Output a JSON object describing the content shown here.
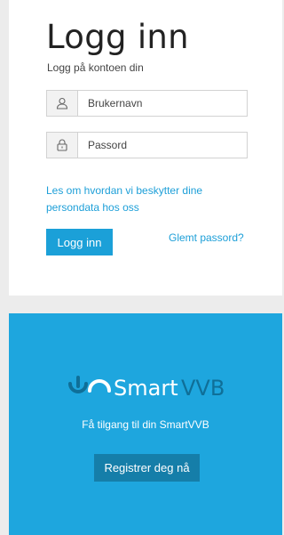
{
  "login": {
    "title": "Logg inn",
    "subtitle": "Logg på kontoen din",
    "username_placeholder": "Brukernavn",
    "password_placeholder": "Passord",
    "privacy_link": "Les om hvordan vi beskytter dine persondata hos oss",
    "login_button": "Logg inn",
    "forgot_link": "Glemt passord?",
    "username_icon": "user-icon",
    "password_icon": "lock-icon"
  },
  "promo": {
    "logo_text": "SmartVVB",
    "tagline": "Få tilgang til din SmartVVB",
    "register_button": "Registrer deg nå"
  },
  "colors": {
    "accent": "#1ba0d8",
    "promo_background": "#1ea6de",
    "register_button": "#157ea9"
  }
}
